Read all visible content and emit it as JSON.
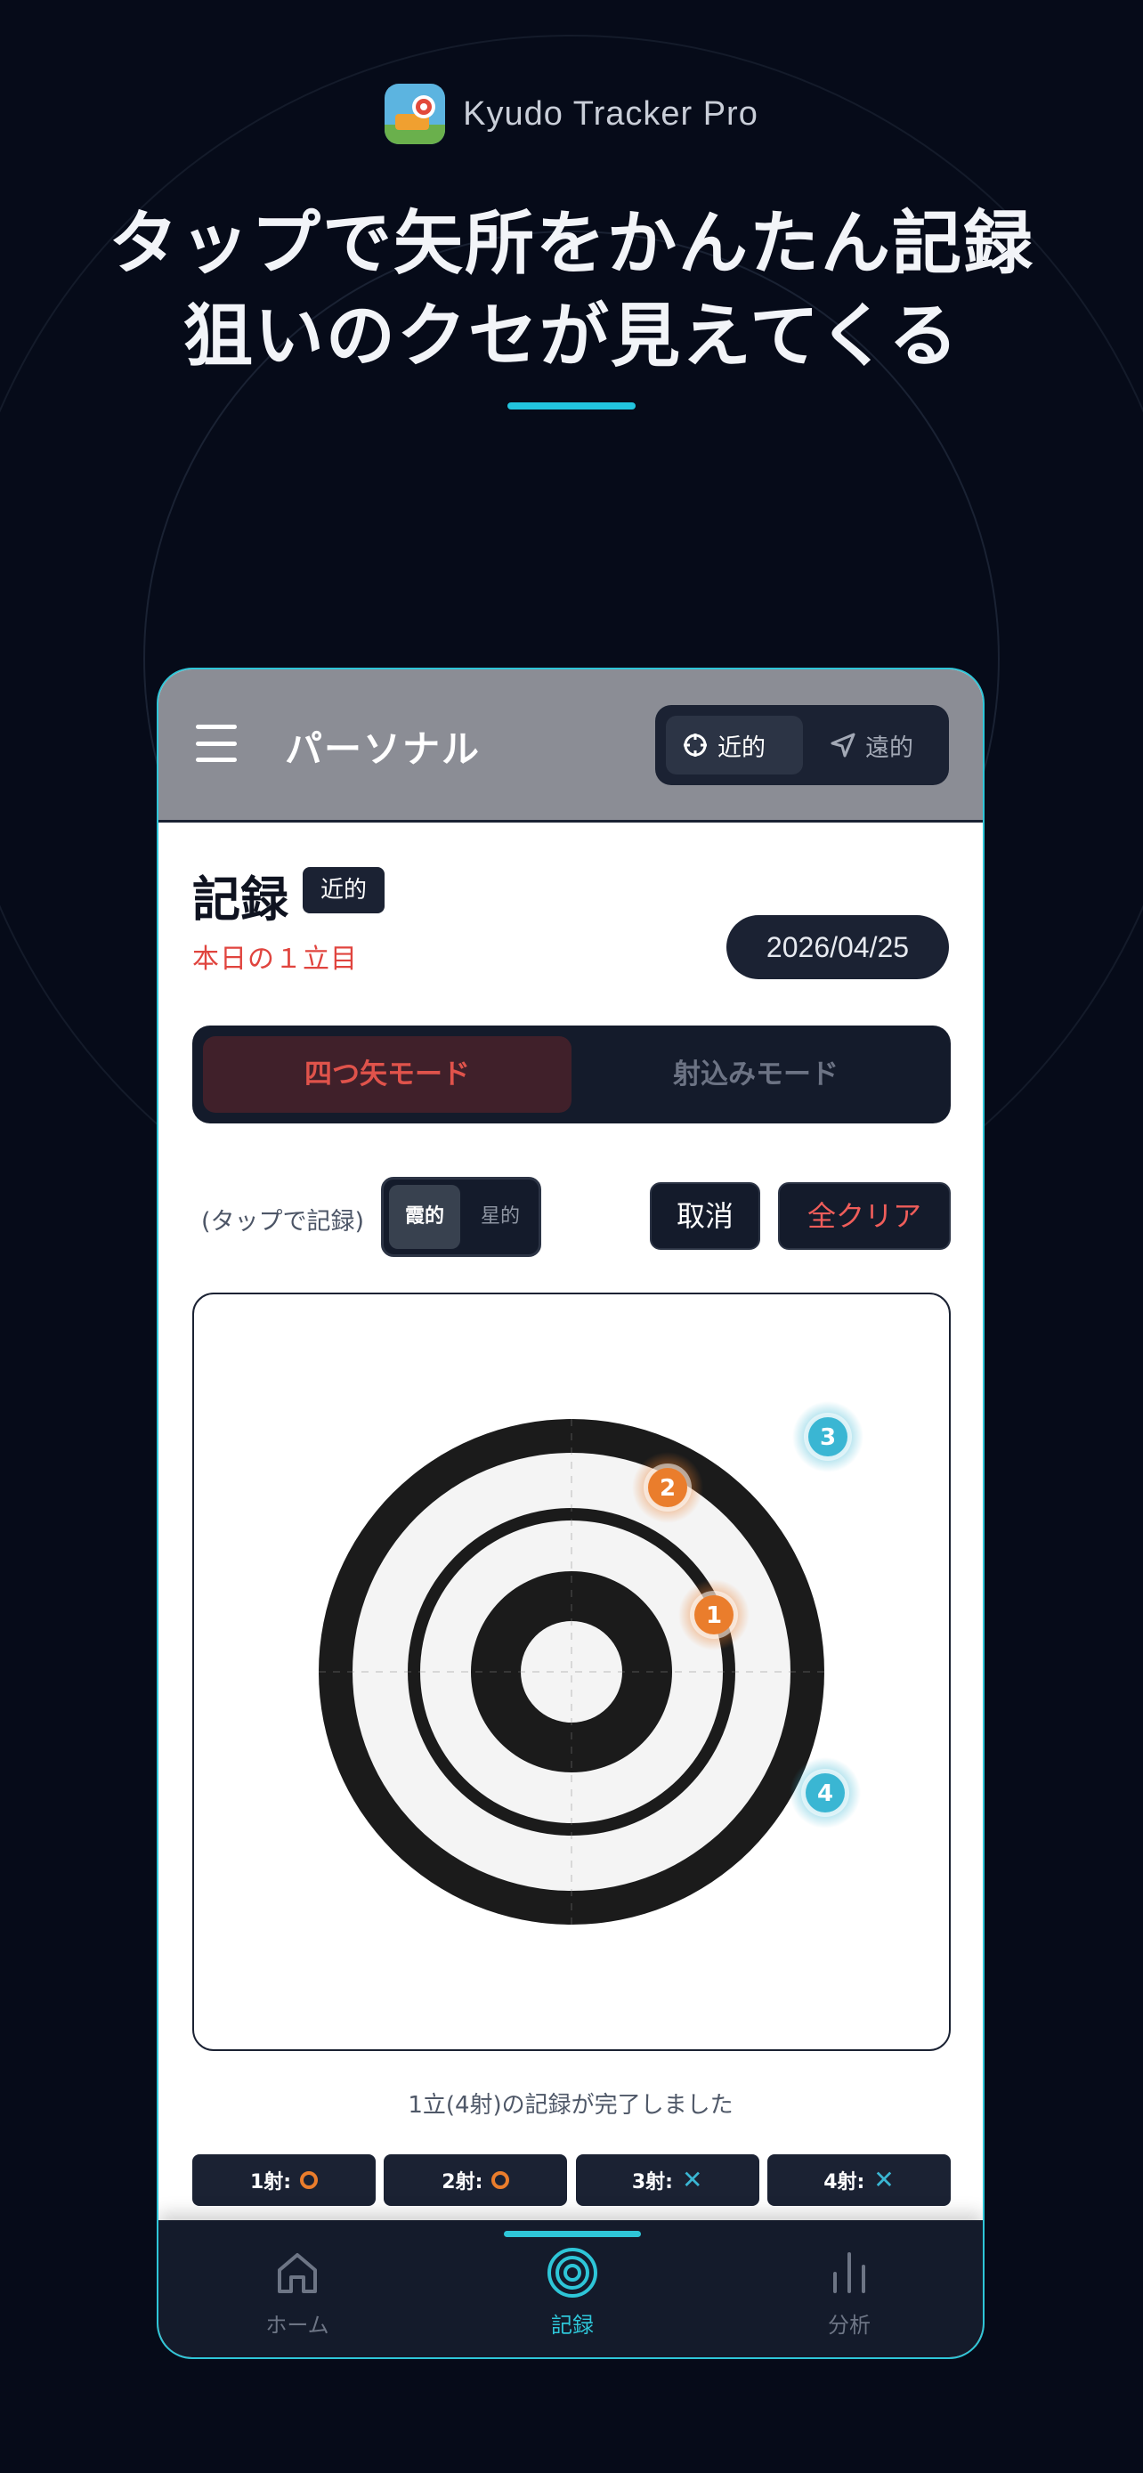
{
  "promo": {
    "app_name": "Kyudo Tracker Pro",
    "headline_line1": "タップで矢所をかんたん記録",
    "headline_line2": "狙いのクセが見えてくる"
  },
  "appbar": {
    "title": "パーソナル",
    "distance_options": [
      "近的",
      "遠的"
    ],
    "selected_distance": "近的"
  },
  "record": {
    "title": "記録",
    "badge": "近的",
    "subtitle": "本日の１立目",
    "date": "2026/04/25"
  },
  "modes": {
    "options": [
      "四つ矢モード",
      "射込みモード"
    ],
    "selected": "四つ矢モード"
  },
  "controls": {
    "tap_hint": "(タップで記録)",
    "ring_options": [
      "霞的",
      "星的"
    ],
    "selected_ring": "霞的",
    "cancel_label": "取消",
    "clear_label": "全クリア"
  },
  "target": {
    "shots": [
      {
        "number": "1",
        "result": "hit"
      },
      {
        "number": "2",
        "result": "hit"
      },
      {
        "number": "3",
        "result": "miss"
      },
      {
        "number": "4",
        "result": "miss"
      }
    ],
    "colors": {
      "hit": "#ea7d2c",
      "miss": "#3ab6d3",
      "ring": "#1b1b1b"
    }
  },
  "summary": {
    "complete_text": "1立(4射)の記録が完了しました",
    "shot_labels": [
      "1射:",
      "2射:",
      "3射:",
      "4射:"
    ]
  },
  "tabs": [
    {
      "label": "ホーム",
      "icon": "home-icon"
    },
    {
      "label": "記録",
      "icon": "target-icon"
    },
    {
      "label": "分析",
      "icon": "bar-chart-icon"
    }
  ],
  "accent_color": "#2ec6d8"
}
